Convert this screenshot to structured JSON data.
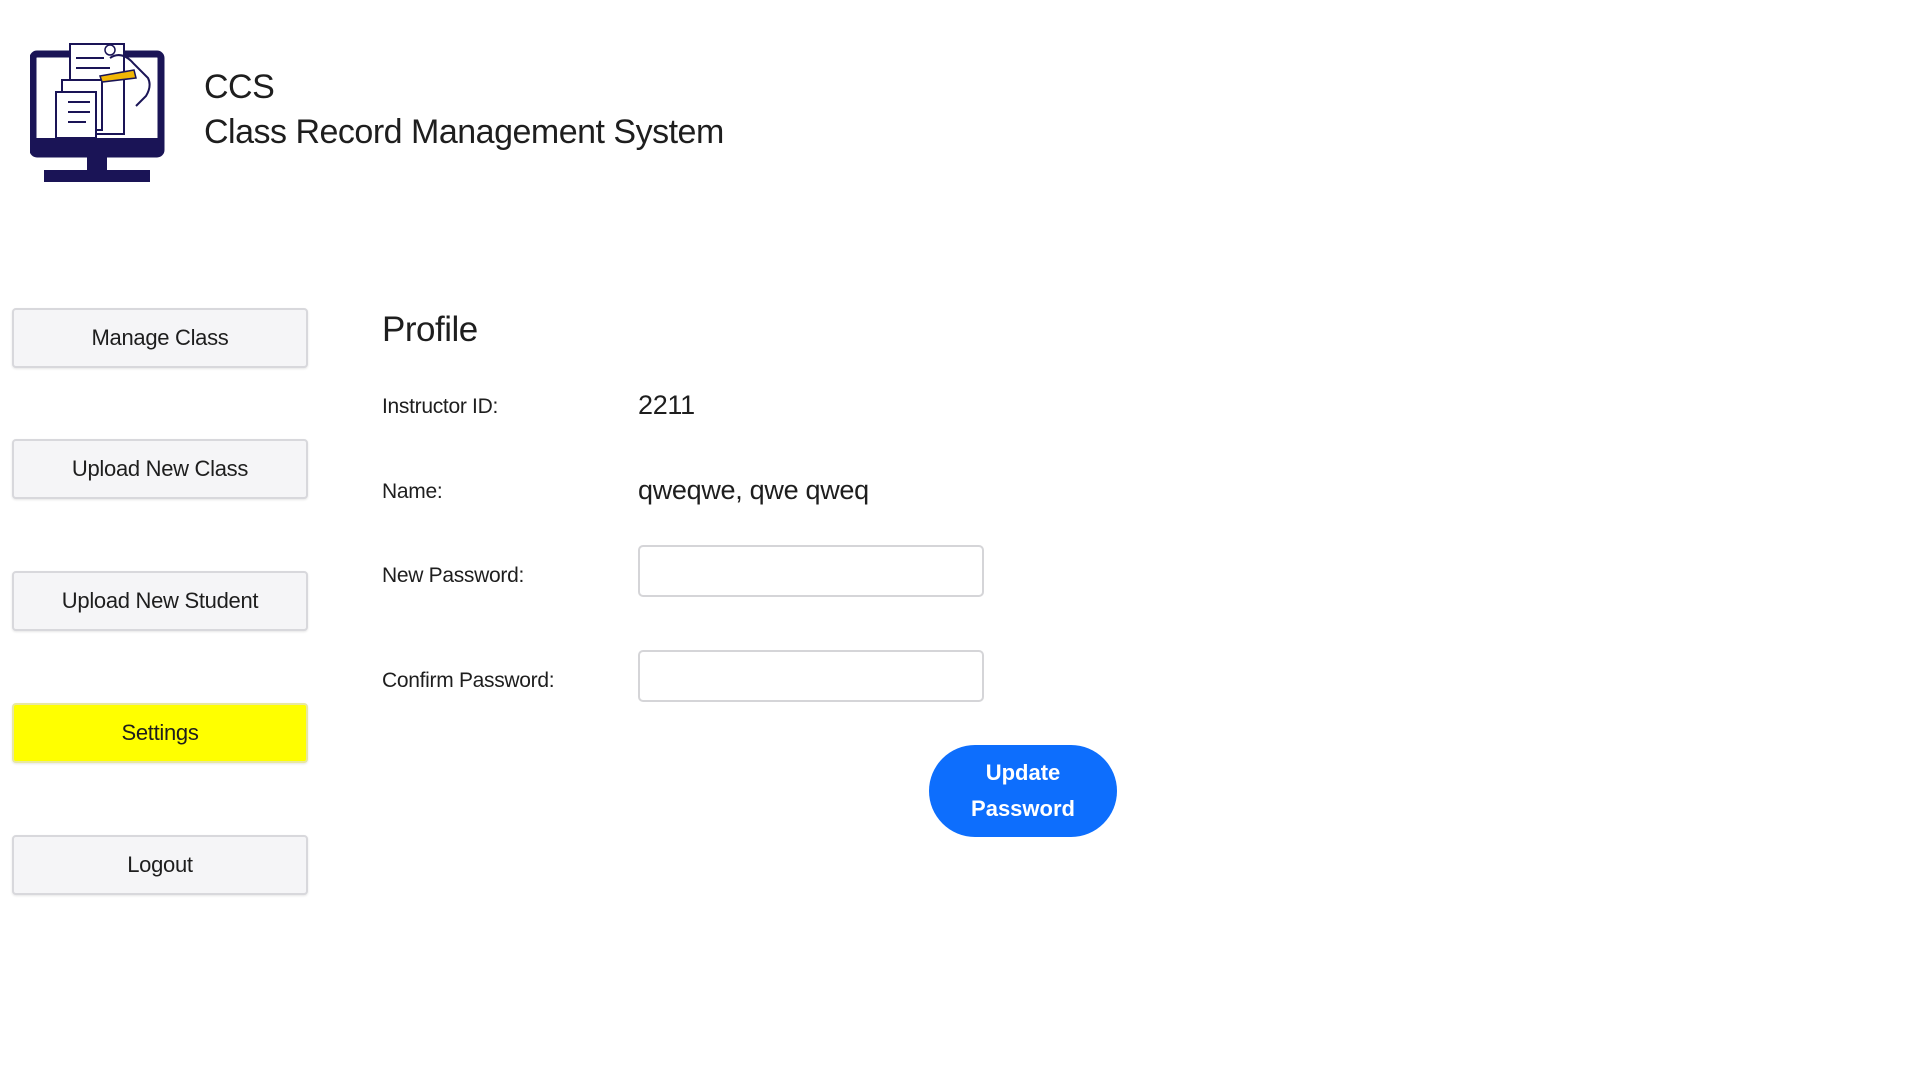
{
  "header": {
    "abbrev": "CCS",
    "app_name": "Class Record Management System",
    "logo_icon": "computer-document-logo-icon"
  },
  "sidebar": {
    "items": [
      {
        "label": "Manage Class",
        "active": false
      },
      {
        "label": "Upload New Class",
        "active": false
      },
      {
        "label": "Upload New Student",
        "active": false
      },
      {
        "label": "Settings",
        "active": true
      },
      {
        "label": "Logout",
        "active": false
      }
    ]
  },
  "profile": {
    "title": "Profile",
    "instructor_id_label": "Instructor ID:",
    "instructor_id_value": "2211",
    "name_label": "Name:",
    "name_value": "qweqwe, qwe qweq",
    "new_password_label": "New Password:",
    "new_password_value": "",
    "confirm_password_label": "Confirm Password:",
    "confirm_password_value": "",
    "update_button_label": "Update Password"
  },
  "colors": {
    "active_nav": "#ffff00",
    "primary_button": "#0d6efd",
    "logo_navy": "#1a1456",
    "logo_accent": "#f2b705"
  }
}
